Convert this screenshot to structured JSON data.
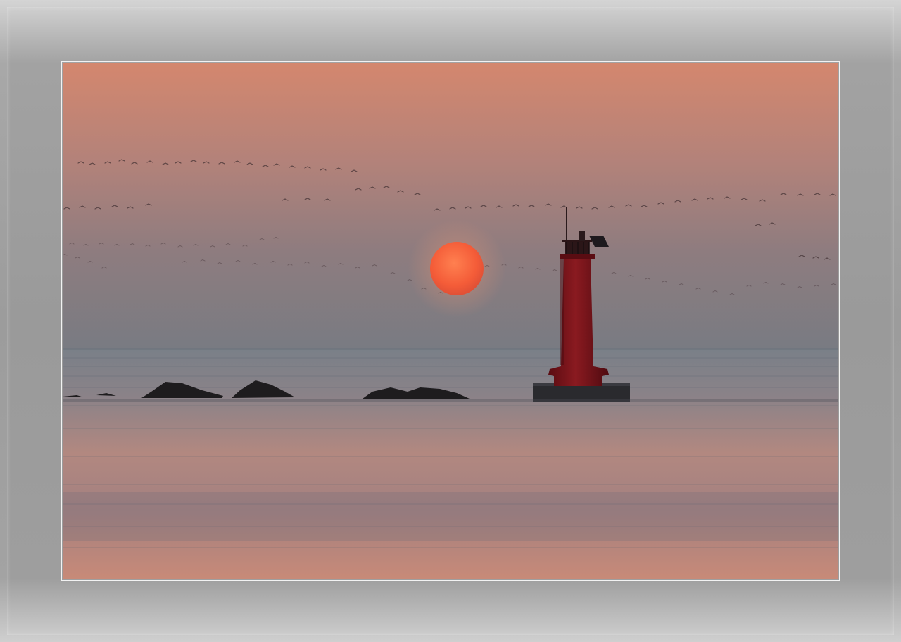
{
  "image": {
    "description_tag": "sunset-lighthouse-seascape",
    "colors": {
      "sky_top": "#d4876e",
      "sky_mid": "#9a7d7a",
      "sky_horizon": "#777a82",
      "sun": "#ff6a40",
      "lighthouse": "#7a1016",
      "sea_reflection": "#d48c76",
      "frame": "#9c9c9c"
    }
  }
}
